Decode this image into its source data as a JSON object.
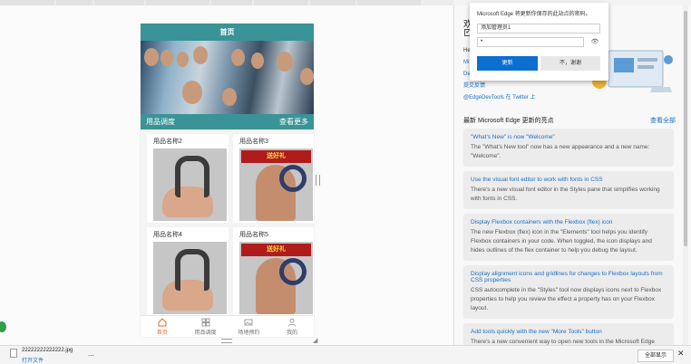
{
  "app": {
    "header_title": "首页",
    "section_title": "用品调度",
    "section_more": "查看更多",
    "products": [
      {
        "name": "用品名称2",
        "image": "hand-grip"
      },
      {
        "name": "用品名称3",
        "image": "chest-expander"
      },
      {
        "name": "用品名称4",
        "image": "hand-grip"
      },
      {
        "name": "用品名称5",
        "image": "chest-expander"
      }
    ],
    "banner_text": "送好礼",
    "tabs": [
      {
        "label": "首页",
        "icon": "home-icon",
        "active": true
      },
      {
        "label": "用品调度",
        "icon": "grid-icon",
        "active": false
      },
      {
        "label": "场地预约",
        "icon": "image-icon",
        "active": false
      },
      {
        "label": "我的",
        "icon": "user-icon",
        "active": false
      }
    ],
    "accent": "#3a9397",
    "active_tab_color": "#e36a35"
  },
  "devtools": {
    "welcome_partial": "欢",
    "checkbox_mark": "✔",
    "links": [
      {
        "text": "He",
        "kind": "text"
      },
      {
        "text": "Mi",
        "kind": "link"
      },
      {
        "text": "De",
        "kind": "link"
      },
      {
        "text": "提交反馈",
        "kind": "link"
      },
      {
        "text": "@EdgeDevTools 在 Twitter 上",
        "kind": "link"
      }
    ],
    "news_title": "最新 Microsoft Edge 更新的亮点",
    "view_all": "查看全部",
    "cards": [
      {
        "heading": "\"What's New\" is now \"Welcome\"",
        "desc": "The \"What's New tool\" now has a new appearance and a new name: \"Welcome\"."
      },
      {
        "heading": "Use the visual font editor to work with fonts in CSS",
        "desc": "There's a new visual font editor in the Styles pane that simplifies working with fonts in CSS."
      },
      {
        "heading": "Display Flexbox containers with the Flexbox (flex) icon",
        "desc": "The new Flexbox (flex) icon in the \"Elements\" tool helps you identify Flexbox containers in your code. When toggled, the icon displays and hides outlines of the flex container to help you debug the layout."
      },
      {
        "heading": "Display alignment icons and gridlines for changes to Flexbox layouts from CSS properties",
        "desc": "CSS autocomplete in the \"Styles\" tool now displays icons next to Flexbox properties to help you review the effect a property has on your Flexbox layout."
      },
      {
        "heading": "Add tools quickly with the new \"More Tools\" button",
        "desc": "There's a new convenient way to open new tools in the Microsoft Edge"
      }
    ]
  },
  "password_prompt": {
    "title": "Microsoft Edge 将更新你保存的此站点的密码。",
    "username": "添加管理员1",
    "password": "•",
    "update_label": "更新",
    "decline_label": "不，谢谢"
  },
  "download": {
    "filename": "22222222222222.jpg",
    "open_label": "打开文件",
    "more_label": "...",
    "show_all_label": "全部显示",
    "close_label": "✕"
  }
}
